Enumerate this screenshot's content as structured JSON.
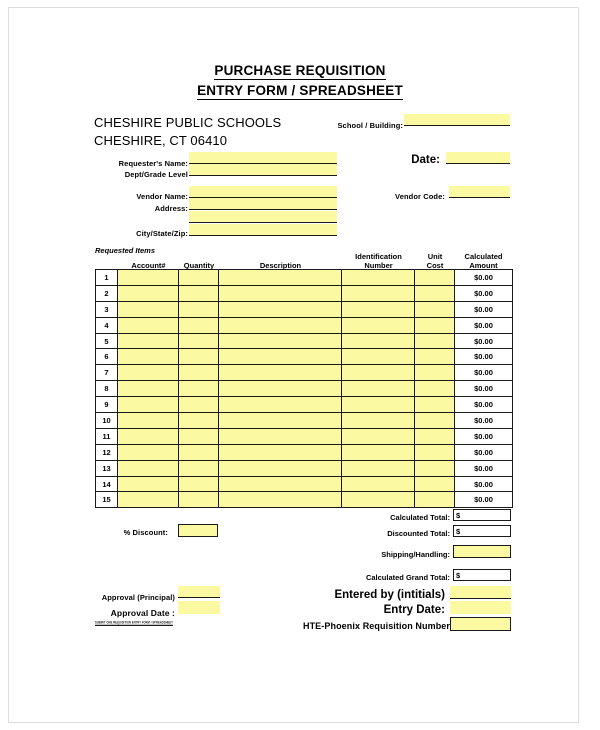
{
  "document": {
    "title_line1": "PURCHASE REQUISITION",
    "title_line2": "ENTRY FORM / SPREADSHEET",
    "district_line1": "CHESHIRE PUBLIC SCHOOLS",
    "district_line2": "CHESHIRE, CT 06410",
    "footnote": "SUBMIT ONE REQUISITION ENTRY FORM / SPREADSHEET"
  },
  "header_fields": {
    "school_building_label": "School / Building:",
    "school_building_value": "",
    "date_label": "Date:",
    "date_value": "",
    "requesters_name_label": "Requester's Name:",
    "requesters_name_value": "",
    "dept_grade_label": "Dept/Grade Level",
    "dept_grade_value": "",
    "vendor_name_label": "Vendor Name:",
    "vendor_name_value": "",
    "vendor_code_label": "Vendor Code:",
    "vendor_code_value": "",
    "address_label": "Address:",
    "address_value_1": "",
    "address_value_2": "",
    "city_state_zip_label": "City/State/Zip:",
    "city_state_zip_value": ""
  },
  "items_table": {
    "section_label": "Requested Items",
    "columns": [
      {
        "label": "",
        "key": "row"
      },
      {
        "label": "Account#",
        "key": "account"
      },
      {
        "label": "Quantity",
        "key": "quantity"
      },
      {
        "label": "Description",
        "key": "description"
      },
      {
        "label_line1": "Identification",
        "label_line2": "Number",
        "key": "ident"
      },
      {
        "label_line1": "Unit",
        "label_line2": "Cost",
        "key": "unitcost"
      },
      {
        "label_line1": "Calculated",
        "label_line2": "Amount",
        "key": "amount"
      }
    ],
    "rows": [
      {
        "row": "1",
        "account": "",
        "quantity": "",
        "description": "",
        "ident": "",
        "unitcost": "",
        "amount": "$0.00"
      },
      {
        "row": "2",
        "account": "",
        "quantity": "",
        "description": "",
        "ident": "",
        "unitcost": "",
        "amount": "$0.00"
      },
      {
        "row": "3",
        "account": "",
        "quantity": "",
        "description": "",
        "ident": "",
        "unitcost": "",
        "amount": "$0.00"
      },
      {
        "row": "4",
        "account": "",
        "quantity": "",
        "description": "",
        "ident": "",
        "unitcost": "",
        "amount": "$0.00"
      },
      {
        "row": "5",
        "account": "",
        "quantity": "",
        "description": "",
        "ident": "",
        "unitcost": "",
        "amount": "$0.00"
      },
      {
        "row": "6",
        "account": "",
        "quantity": "",
        "description": "",
        "ident": "",
        "unitcost": "",
        "amount": "$0.00"
      },
      {
        "row": "7",
        "account": "",
        "quantity": "",
        "description": "",
        "ident": "",
        "unitcost": "",
        "amount": "$0.00"
      },
      {
        "row": "8",
        "account": "",
        "quantity": "",
        "description": "",
        "ident": "",
        "unitcost": "",
        "amount": "$0.00"
      },
      {
        "row": "9",
        "account": "",
        "quantity": "",
        "description": "",
        "ident": "",
        "unitcost": "",
        "amount": "$0.00"
      },
      {
        "row": "10",
        "account": "",
        "quantity": "",
        "description": "",
        "ident": "",
        "unitcost": "",
        "amount": "$0.00"
      },
      {
        "row": "11",
        "account": "",
        "quantity": "",
        "description": "",
        "ident": "",
        "unitcost": "",
        "amount": "$0.00"
      },
      {
        "row": "12",
        "account": "",
        "quantity": "",
        "description": "",
        "ident": "",
        "unitcost": "",
        "amount": "$0.00"
      },
      {
        "row": "13",
        "account": "",
        "quantity": "",
        "description": "",
        "ident": "",
        "unitcost": "",
        "amount": "$0.00"
      },
      {
        "row": "14",
        "account": "",
        "quantity": "",
        "description": "",
        "ident": "",
        "unitcost": "",
        "amount": "$0.00"
      },
      {
        "row": "15",
        "account": "",
        "quantity": "",
        "description": "",
        "ident": "",
        "unitcost": "",
        "amount": "$0.00"
      }
    ]
  },
  "totals": {
    "calculated_total_label": "Calculated Total:",
    "calculated_total_value": "$",
    "discount_label": "% Discount:",
    "discount_value": "",
    "discounted_total_label": "Discounted Total:",
    "discounted_total_value": "$",
    "shipping_handling_label": "Shipping/Handling:",
    "shipping_handling_value": "",
    "grand_total_label": "Calculated Grand Total:",
    "grand_total_value": "$"
  },
  "approval": {
    "approval_principal_label": "Approval (Principal)",
    "approval_principal_value": "",
    "approval_date_label": "Approval Date :",
    "approval_date_value": "",
    "entered_by_label": "Entered by (intitials)",
    "entered_by_value": "",
    "entry_date_label": "Entry Date:",
    "entry_date_value": "",
    "hte_phoenix_label": "HTE-Phoenix Requisition Number",
    "hte_phoenix_value": ""
  },
  "colors": {
    "field_fill": "#fbf9a1",
    "rule": "#1a1a1a",
    "page_border": "#dcdcdc",
    "paper": "#ffffff"
  }
}
